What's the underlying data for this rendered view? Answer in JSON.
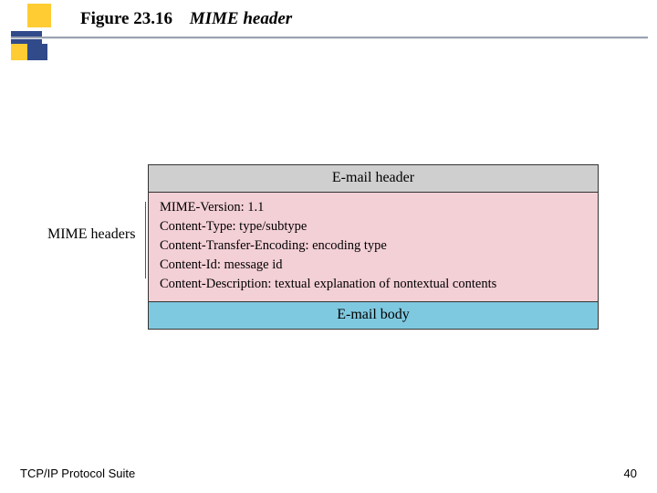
{
  "header": {
    "figure_number": "Figure 23.16",
    "figure_title": "MIME header"
  },
  "diagram": {
    "side_label": "MIME headers",
    "email_header": "E-mail header",
    "mime_lines": [
      "MIME-Version: 1.1",
      "Content-Type: type/subtype",
      "Content-Transfer-Encoding: encoding type",
      "Content-Id: message id",
      "Content-Description: textual explanation of nontextual contents"
    ],
    "email_body": "E-mail body"
  },
  "footer": {
    "left": "TCP/IP Protocol Suite",
    "page": "40"
  }
}
